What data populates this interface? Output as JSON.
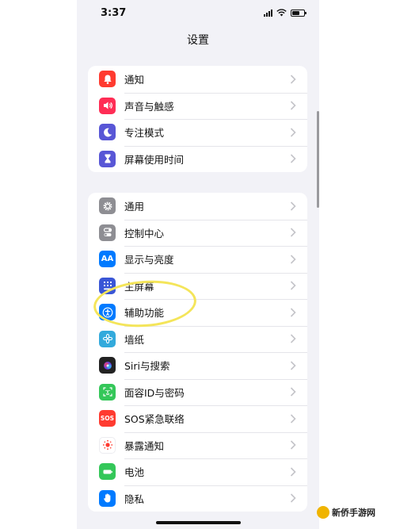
{
  "status_bar": {
    "time": "3:37"
  },
  "header": {
    "title": "设置"
  },
  "groups": [
    {
      "items": [
        {
          "label": "通知",
          "icon": "bell-icon",
          "color": "#ff3b30"
        },
        {
          "label": "声音与触感",
          "icon": "speaker-icon",
          "color": "#ff2d55"
        },
        {
          "label": "专注模式",
          "icon": "moon-icon",
          "color": "#5856d6"
        },
        {
          "label": "屏幕使用时间",
          "icon": "hourglass-icon",
          "color": "#5856d6"
        }
      ]
    },
    {
      "items": [
        {
          "label": "通用",
          "icon": "gear-icon",
          "color": "#8e8e93"
        },
        {
          "label": "控制中心",
          "icon": "toggles-icon",
          "color": "#8e8e93"
        },
        {
          "label": "显示与亮度",
          "icon": "aa-icon",
          "icon_text": "AA",
          "color": "#007aff"
        },
        {
          "label": "主屏幕",
          "icon": "grid-icon",
          "color": "#3a56d6"
        },
        {
          "label": "辅助功能",
          "icon": "accessibility-icon",
          "color": "#007aff"
        },
        {
          "label": "墙纸",
          "icon": "flower-icon",
          "color": "#33aadc"
        },
        {
          "label": "Siri与搜索",
          "icon": "siri-icon",
          "color": "#222222"
        },
        {
          "label": "面容ID与密码",
          "icon": "faceid-icon",
          "color": "#34c759"
        },
        {
          "label": "SOS紧急联络",
          "icon": "sos-icon",
          "icon_text": "SOS",
          "color": "#ff3b30"
        },
        {
          "label": "暴露通知",
          "icon": "exposure-icon",
          "color": "#ffffff"
        },
        {
          "label": "电池",
          "icon": "battery-icon",
          "color": "#34c759"
        },
        {
          "label": "隐私",
          "icon": "hand-icon",
          "color": "#007aff"
        }
      ]
    }
  ],
  "watermark": {
    "text": "新侨手游网"
  }
}
